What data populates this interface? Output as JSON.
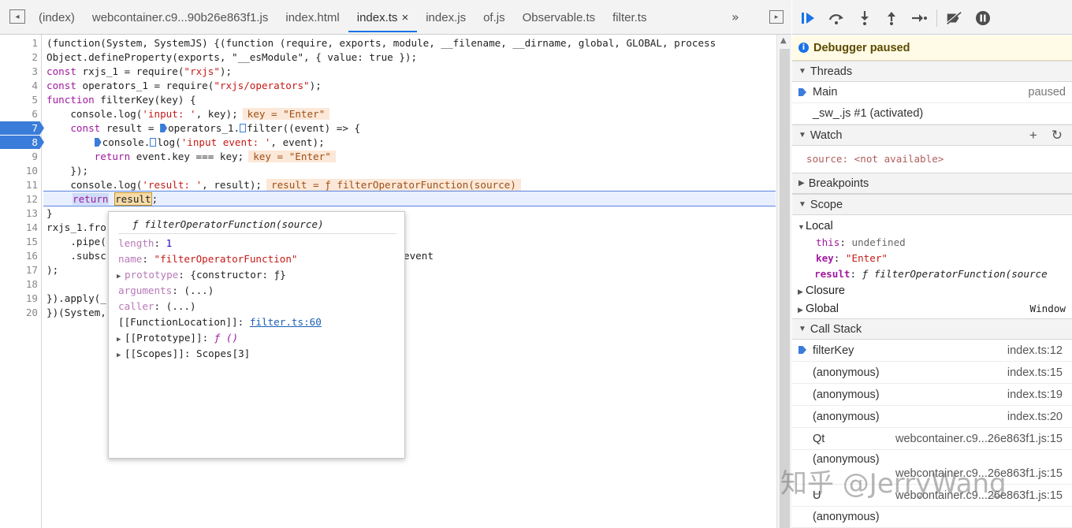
{
  "tabs": [
    {
      "label": "(index)"
    },
    {
      "label": "webcontainer.c9...90b26e863f1.js"
    },
    {
      "label": "index.html"
    },
    {
      "label": "index.ts",
      "active": true,
      "close": "×"
    },
    {
      "label": "index.js"
    },
    {
      "label": "of.js"
    },
    {
      "label": "Observable.ts"
    },
    {
      "label": "filter.ts"
    }
  ],
  "more_tabs": "»",
  "code": {
    "line_numbers": [
      "1",
      "2",
      "3",
      "4",
      "5",
      "6",
      "7",
      "8",
      "9",
      "10",
      "11",
      "12",
      "13",
      "14",
      "15",
      "16",
      "17",
      "18",
      "19",
      "20"
    ],
    "l1": "(function(System, SystemJS) {(function (require, exports, module, __filename, __dirname, global, GLOBAL, process",
    "l2": "Object.defineProperty(exports, \"__esModule\", { value: true });",
    "l3a": "const ",
    "l3b": "rxjs_1 = require(",
    "l3c": "\"rxjs\"",
    "l3d": ");",
    "l4a": "const ",
    "l4b": "operators_1 = require(",
    "l4c": "\"rxjs/operators\"",
    "l4d": ");",
    "l5a": "function ",
    "l5b": "filterKey(key) {",
    "l6a": "    console.log(",
    "l6b": "'input: '",
    "l6c": ", key);",
    "l6v": "key = \"Enter\"",
    "l7a": "    const ",
    "l7b": "result = ",
    "l7c": "operators_1.",
    "l7d": "filter((event) => {",
    "l8a": "        ",
    "l8b": "console.",
    "l8c": "log(",
    "l8d": "'input event: '",
    "l8e": ", event);",
    "l9a": "        return ",
    "l9b": "event.key === key;",
    "l9v": "key = \"Enter\"",
    "l10": "    });",
    "l11a": "    console.log(",
    "l11b": "'result: '",
    "l11c": ", result);",
    "l11v": "result = ƒ filterOperatorFunction(source)",
    "l12a": "return",
    "l12b": "result",
    "l12c": ";",
    "l13": "}",
    "l14": "rxjs_1.fro",
    "l15": "    .pipe(",
    "l16a": "    .subsc",
    "l16b": "event",
    "l17": ");",
    "l18": "",
    "l19": "}).apply(_",
    "l20": "})(System,"
  },
  "popover": {
    "title": "ƒ filterOperatorFunction(source)",
    "length_key": "length",
    "length_val": "1",
    "name_key": "name",
    "name_val": "\"filterOperatorFunction\"",
    "prototype_key": "prototype",
    "prototype_val": "{constructor: ƒ}",
    "arguments_key": "arguments",
    "arguments_val": "(...)",
    "caller_key": "caller",
    "caller_val": "(...)",
    "fnloc_key": "[[FunctionLocation]]",
    "fnloc_val": "filter.ts:60",
    "proto_key": "[[Prototype]]",
    "proto_val": "ƒ ()",
    "scopes_key": "[[Scopes]]",
    "scopes_val": "Scopes[3]"
  },
  "sidebar": {
    "paused": "Debugger paused",
    "threads": {
      "header": "Threads",
      "items": [
        {
          "label": "Main",
          "status": "paused"
        },
        {
          "label": "_sw_.js #1 (activated)",
          "status": ""
        }
      ]
    },
    "watch": {
      "header": "Watch",
      "add": "+",
      "refresh": "↻",
      "expr": "source: <not available>"
    },
    "breakpoints": {
      "header": "Breakpoints"
    },
    "scope": {
      "header": "Scope",
      "local_header": "Local",
      "this_key": "this",
      "this_val": "undefined",
      "key_key": "key",
      "key_val": "\"Enter\"",
      "result_key": "result",
      "result_val": "ƒ filterOperatorFunction(source",
      "closure": "Closure",
      "global": "Global",
      "global_val": "Window"
    },
    "callstack": {
      "header": "Call Stack",
      "items": [
        {
          "fn": "filterKey",
          "file": "index.ts:12"
        },
        {
          "fn": "(anonymous)",
          "file": "index.ts:15"
        },
        {
          "fn": "(anonymous)",
          "file": "index.ts:19"
        },
        {
          "fn": "(anonymous)",
          "file": "index.ts:20"
        },
        {
          "fn": "Qt",
          "file": "webcontainer.c9...26e863f1.js:15"
        },
        {
          "fn": "(anonymous)",
          "file": "webcontainer.c9...26e863f1.js:15"
        },
        {
          "fn": "U",
          "file": "webcontainer.c9...26e863f1.js:15"
        },
        {
          "fn": "(anonymous)",
          "file": ""
        }
      ]
    }
  },
  "watermark": "知乎 @JerryWang",
  "colors": {
    "accent": "#1a73e8",
    "breakpoint": "#3a7cd9",
    "inline_value_bg": "#fce8d8",
    "paused_banner": "#fffbe6"
  }
}
